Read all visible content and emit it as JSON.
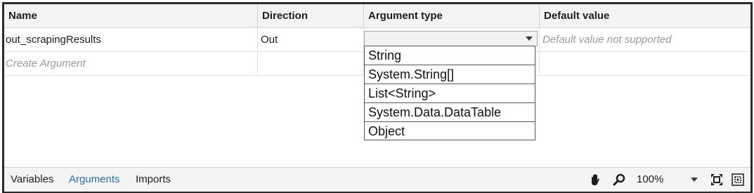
{
  "columns": {
    "name": "Name",
    "direction": "Direction",
    "argument_type": "Argument type",
    "default_value": "Default value"
  },
  "rows": [
    {
      "name": "out_scrapingResults",
      "direction": "Out",
      "argument_type": "",
      "default_value": "Default value not supported"
    }
  ],
  "create_placeholder": "Create Argument",
  "type_options": [
    "String",
    "System.String[]",
    "List<String>",
    "System.Data.DataTable",
    "Object"
  ],
  "footer": {
    "tabs": [
      "Variables",
      "Arguments",
      "Imports"
    ],
    "active_tab": "Arguments",
    "zoom": "100%"
  },
  "icons": {
    "pan": "hand-icon",
    "zoom": "magnifier-icon",
    "fit": "fit-to-screen-icon",
    "overview": "overview-icon"
  },
  "colors": {
    "active_tab": "#2f6fa8",
    "header_bg": "#f3f3f3",
    "footer_bg": "#f4f4f4"
  }
}
